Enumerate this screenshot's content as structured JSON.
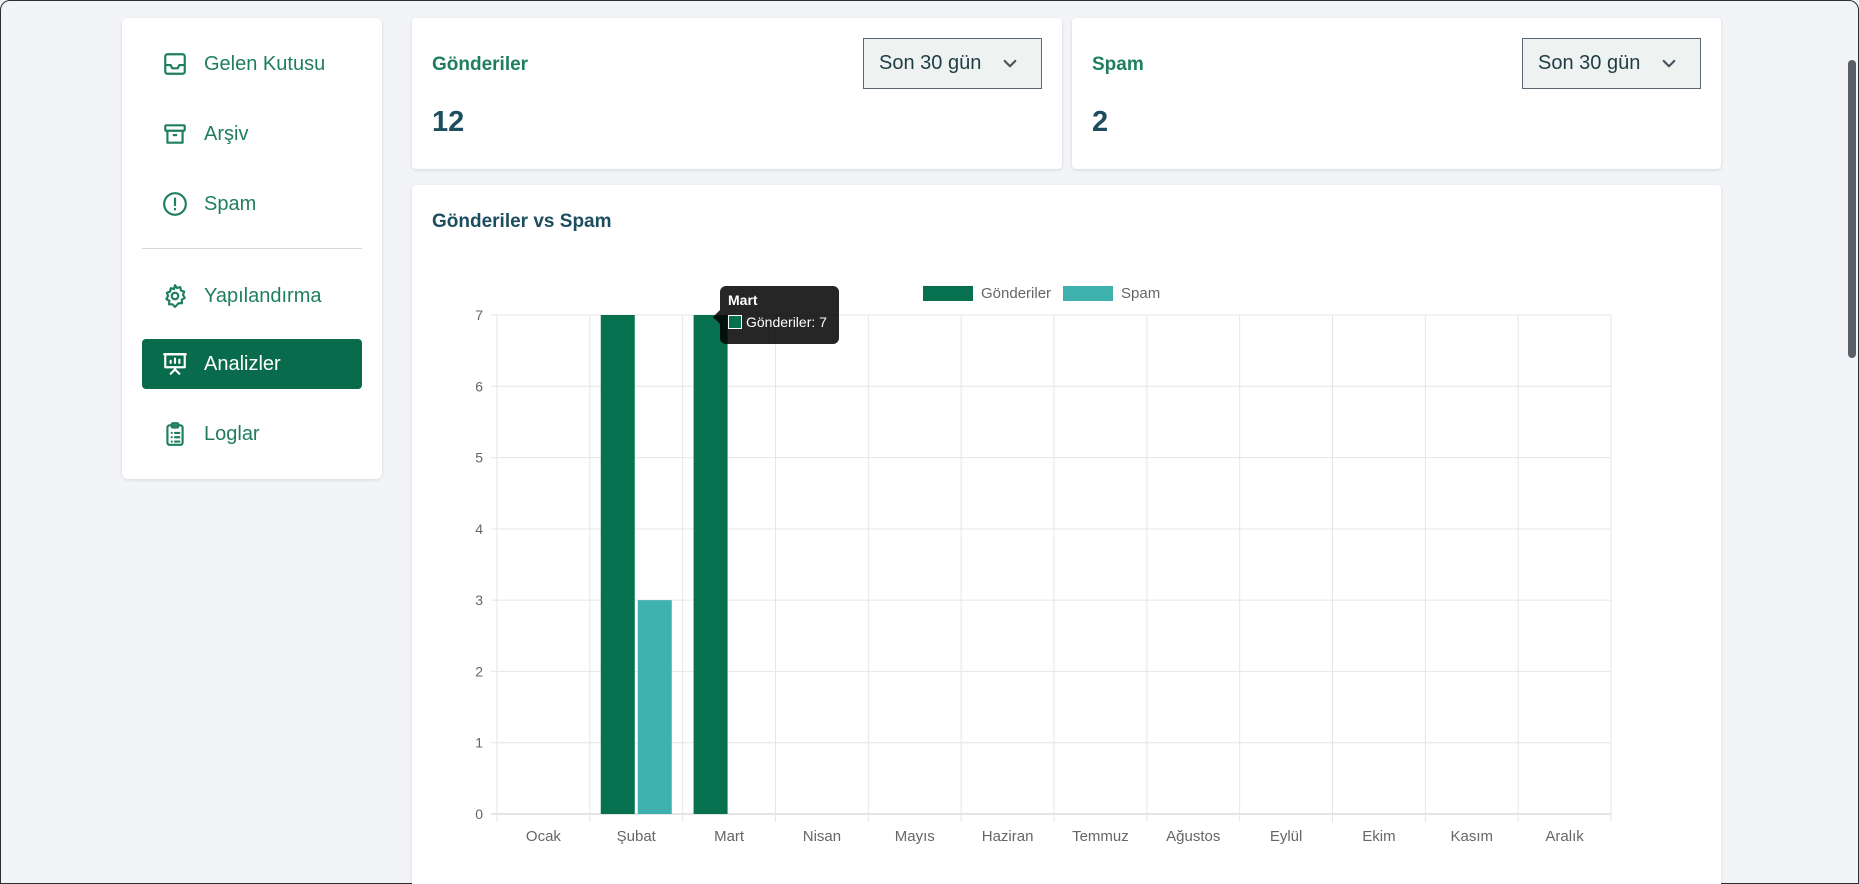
{
  "sidebar": {
    "items": [
      {
        "label": "Gelen Kutusu",
        "icon": "inbox-icon"
      },
      {
        "label": "Arşiv",
        "icon": "archive-icon"
      },
      {
        "label": "Spam",
        "icon": "alert-circle-icon"
      },
      {
        "label": "Yapılandırma",
        "icon": "gear-icon"
      },
      {
        "label": "Analizler",
        "icon": "presentation-chart-icon",
        "active": true
      },
      {
        "label": "Loglar",
        "icon": "clipboard-list-icon"
      }
    ]
  },
  "stats": {
    "submissions": {
      "title": "Gönderiler",
      "value": "12",
      "range": "Son 30 gün"
    },
    "spam": {
      "title": "Spam",
      "value": "2",
      "range": "Son 30 gün"
    }
  },
  "chart_section": {
    "title": "Gönderiler vs Spam"
  },
  "tooltip": {
    "title": "Mart",
    "text": "Gönderiler: 7"
  },
  "colors": {
    "accent": "#076b4c",
    "submissions": "#07704f",
    "spam": "#3eb1af",
    "text_green": "#1f7f5c"
  },
  "chart_data": {
    "type": "bar",
    "categories": [
      "Ocak",
      "Şubat",
      "Mart",
      "Nisan",
      "Mayıs",
      "Haziran",
      "Temmuz",
      "Ağustos",
      "Eylül",
      "Ekim",
      "Kasım",
      "Aralık"
    ],
    "series": [
      {
        "name": "Gönderiler",
        "values": [
          0,
          7,
          7,
          0,
          0,
          0,
          0,
          0,
          0,
          0,
          0,
          0
        ]
      },
      {
        "name": "Spam",
        "values": [
          0,
          3,
          0,
          0,
          0,
          0,
          0,
          0,
          0,
          0,
          0,
          0
        ]
      }
    ],
    "ylim": [
      0,
      7
    ],
    "yticks": [
      "0",
      "1",
      "2",
      "3",
      "4",
      "5",
      "6",
      "7"
    ],
    "grid": true,
    "legend": "top-center"
  }
}
